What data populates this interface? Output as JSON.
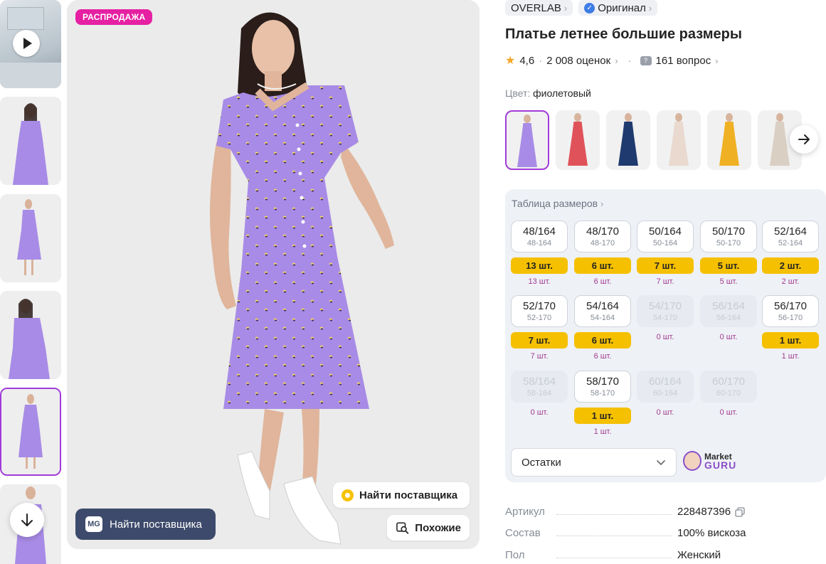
{
  "gallery": {
    "sale_badge": "РАСПРОДАЖА",
    "find_supplier_label": "Найти поставщика",
    "similar_label": "Похожие",
    "mg_logo": "MG",
    "mg_find_supplier_label": "Найти поставщика",
    "thumbnails": [
      "video",
      "photo",
      "photo",
      "photo",
      "photo",
      "photo"
    ]
  },
  "product": {
    "brand": "OVERLAB",
    "original_label": "Оригинал",
    "title": "Платье летнее большие размеры",
    "rating": "4,6",
    "reviews": "2 008 оценок",
    "questions": "161 вопрос",
    "color_label": "Цвет:",
    "color_value": "фиолетовый",
    "color_swatches": [
      {
        "color": "#a88be6"
      },
      {
        "color": "#e0525a"
      },
      {
        "color": "#1f3a6e"
      },
      {
        "color": "#e9d9cf"
      },
      {
        "color": "#efb024"
      },
      {
        "color": "#d9cfc3"
      }
    ]
  },
  "sizes": {
    "table_link": "Таблица размеров",
    "items": [
      {
        "size": "48/164",
        "sub": "48-164",
        "stock": "13 шт.",
        "note": "13 шт.",
        "available": true
      },
      {
        "size": "48/170",
        "sub": "48-170",
        "stock": "6 шт.",
        "note": "6 шт.",
        "available": true
      },
      {
        "size": "50/164",
        "sub": "50-164",
        "stock": "7 шт.",
        "note": "7 шт.",
        "available": true
      },
      {
        "size": "50/170",
        "sub": "50-170",
        "stock": "5 шт.",
        "note": "5 шт.",
        "available": true
      },
      {
        "size": "52/164",
        "sub": "52-164",
        "stock": "2 шт.",
        "note": "2 шт.",
        "available": true
      },
      {
        "size": "52/170",
        "sub": "52-170",
        "stock": "7 шт.",
        "note": "7 шт.",
        "available": true
      },
      {
        "size": "54/164",
        "sub": "54-164",
        "stock": "6 шт.",
        "note": "6 шт.",
        "available": true
      },
      {
        "size": "54/170",
        "sub": "54-170",
        "stock": "",
        "note": "0 шт.",
        "available": false
      },
      {
        "size": "56/164",
        "sub": "56-164",
        "stock": "",
        "note": "0 шт.",
        "available": false
      },
      {
        "size": "56/170",
        "sub": "56-170",
        "stock": "1 шт.",
        "note": "1 шт.",
        "available": true
      },
      {
        "size": "58/164",
        "sub": "58-164",
        "stock": "",
        "note": "0 шт.",
        "available": false
      },
      {
        "size": "58/170",
        "sub": "58-170",
        "stock": "1 шт.",
        "note": "1 шт.",
        "available": true
      },
      {
        "size": "60/164",
        "sub": "60-164",
        "stock": "",
        "note": "0 шт.",
        "available": false
      },
      {
        "size": "60/170",
        "sub": "60-170",
        "stock": "",
        "note": "0 шт.",
        "available": false
      }
    ],
    "select_value": "Остатки",
    "guru_market": "Market",
    "guru_name": "GURU"
  },
  "specs": [
    {
      "key": "Артикул",
      "value": "228487396",
      "copy": true
    },
    {
      "key": "Состав",
      "value": "100% вискоза",
      "copy": false
    },
    {
      "key": "Пол",
      "value": "Женский",
      "copy": false
    }
  ],
  "colors": {
    "accent": "#a13bd8",
    "sale": "#e520a2",
    "stock": "#f5c000",
    "dress": "#a88be6",
    "mg_button": "#3d4a6b"
  }
}
